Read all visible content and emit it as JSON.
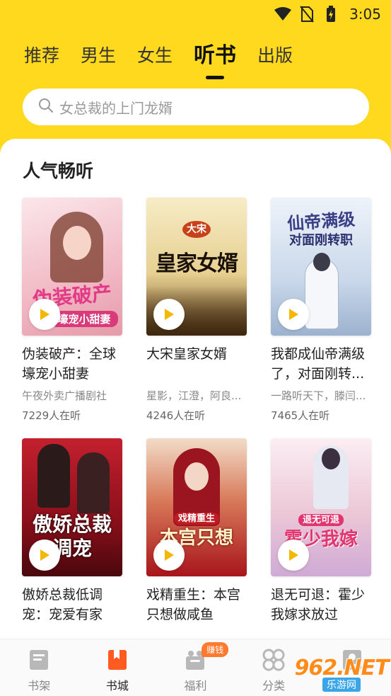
{
  "status_bar": {
    "time": "3:05"
  },
  "tabs": [
    {
      "label": "推荐"
    },
    {
      "label": "男生"
    },
    {
      "label": "女生"
    },
    {
      "label": "听书"
    },
    {
      "label": "出版"
    }
  ],
  "search": {
    "placeholder": "女总裁的上门龙婿"
  },
  "section": {
    "title": "人气畅听"
  },
  "books": [
    {
      "title": "伪装破产：全球壕宠小甜妻",
      "author": "午夜外卖广播剧社",
      "listeners": "7229人在听",
      "cover_text": "伪装破产",
      "cover_sub": "壕宠小甜妻",
      "cover_colors": [
        "#f7d9de",
        "#e9a9b6"
      ]
    },
    {
      "title": "大宋皇家女婿",
      "author": "星影，江澄，阿良...",
      "listeners": "4246人在听",
      "cover_text": "皇家女婿",
      "cover_sub": "大宋",
      "cover_colors": [
        "#f3e3b0",
        "#7a5a2e"
      ]
    },
    {
      "title": "我都成仙帝满级了，对面刚转...",
      "author": "一路听天下，滕闫...",
      "listeners": "7465人在听",
      "cover_text": "仙帝满级",
      "cover_sub": "对面刚转职",
      "cover_colors": [
        "#dbe6f3",
        "#8ea7c7"
      ]
    },
    {
      "title": "傲娇总裁低调宠：宠爱有家",
      "author": "",
      "listeners": "",
      "cover_text": "傲娇总裁",
      "cover_sub": "调宠",
      "cover_colors": [
        "#b81d2a",
        "#5b0b12"
      ]
    },
    {
      "title": "戏精重生：本宫只想做咸鱼",
      "author": "",
      "listeners": "",
      "cover_text": "本宫只想",
      "cover_sub": "戏精重生",
      "cover_colors": [
        "#b52020",
        "#efc9b0"
      ]
    },
    {
      "title": "退无可退：霍少我嫁求放过",
      "author": "",
      "listeners": "",
      "cover_text": "霍少我嫁",
      "cover_sub": "退无可退",
      "cover_colors": [
        "#f6dde6",
        "#d6b4d8"
      ]
    }
  ],
  "bottom_nav": [
    {
      "label": "书架"
    },
    {
      "label": "书城"
    },
    {
      "label": "福利",
      "badge": "赚钱"
    },
    {
      "label": "分类"
    },
    {
      "label": ""
    }
  ],
  "watermark": {
    "logo": "962.NET",
    "sub": "乐游网"
  },
  "colors": {
    "accent": "#FFD91E",
    "play": "#F5B800",
    "badge": "#FF7A2E",
    "active_nav": "#FF5A1F"
  }
}
